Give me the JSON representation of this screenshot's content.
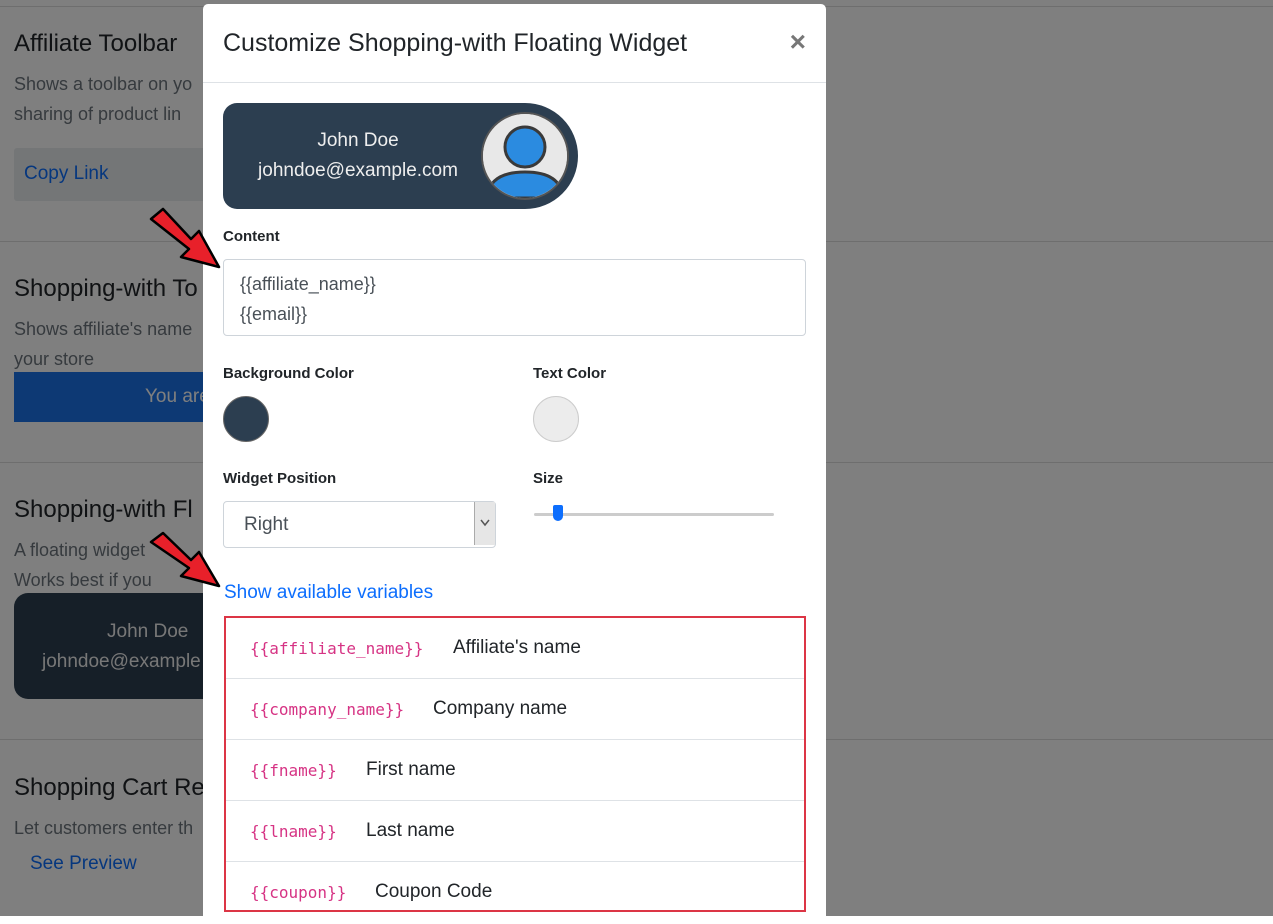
{
  "background": {
    "sections": [
      {
        "title": "Affiliate Toolbar",
        "lines": [
          "Shows a toolbar on yo",
          "sharing of product lin"
        ],
        "button": "Copy Link"
      },
      {
        "title": "Shopping-with To",
        "lines": [
          "Shows affiliate's name",
          "your store"
        ],
        "bar_text": "You are"
      },
      {
        "title": "Shopping-with Fl",
        "lines": [
          "A floating widget",
          "Works best if you"
        ],
        "widget_name": "John Doe",
        "widget_email": "johndoe@example"
      },
      {
        "title": "Shopping Cart Re",
        "lines": [
          "Let customers enter th"
        ],
        "link": "See Preview"
      }
    ]
  },
  "modal": {
    "title": "Customize Shopping-with Floating Widget",
    "close": "×",
    "preview": {
      "name": "John Doe",
      "email": "johndoe@example.com"
    },
    "content_label": "Content",
    "content_lines": [
      "{{affiliate_name}}",
      "{{email}}"
    ],
    "bg_color_label": "Background Color",
    "bg_color": "#2c3e50",
    "text_color_label": "Text Color",
    "text_color": "#ececec",
    "position_label": "Widget Position",
    "position_value": "Right",
    "size_label": "Size",
    "size_fraction": 0.1,
    "show_vars_link": "Show available variables",
    "variables": [
      {
        "code": "{{affiliate_name}}",
        "desc": "Affiliate's name"
      },
      {
        "code": "{{company_name}}",
        "desc": "Company name"
      },
      {
        "code": "{{fname}}",
        "desc": "First name"
      },
      {
        "code": "{{lname}}",
        "desc": "Last name"
      },
      {
        "code": "{{coupon}}",
        "desc": "Coupon Code"
      }
    ]
  },
  "colors": {
    "accent": "#0d6efd",
    "highlight": "#dc3545",
    "annotation_arrow": "#e8202a"
  }
}
